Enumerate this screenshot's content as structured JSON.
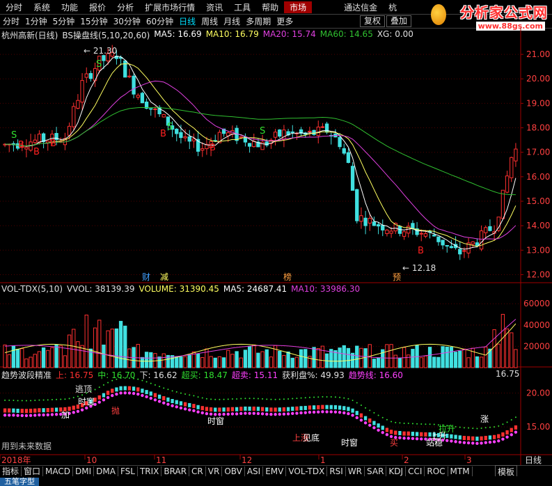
{
  "menubar": {
    "items": [
      "分时",
      "系统",
      "功能",
      "报价",
      "分析",
      "扩展市场行情",
      "资讯",
      "工具",
      "帮助",
      "市场",
      "通达信金",
      "杭"
    ],
    "selected": "市场"
  },
  "logo": {
    "name": "分析家公式网",
    "url": "www.88gs.com"
  },
  "periods": {
    "items": [
      "分时",
      "1分钟",
      "5分钟",
      "15分钟",
      "30分钟",
      "60分钟",
      "日线",
      "周线",
      "月线",
      "多周期",
      "更多"
    ],
    "selected": "日线",
    "right": [
      "复权",
      "叠加"
    ]
  },
  "main_legend": {
    "stock": "杭州高新(日线)",
    "indicator": "BS操盘线(5,10,20,60)",
    "ma5": "MA5: 16.69",
    "ma10": "MA10: 16.79",
    "ma20": "MA20: 15.74",
    "ma60": "MA60: 14.65",
    "xg": "XG: 0.00"
  },
  "vol_legend": {
    "name": "VOL-TDX(5,10)",
    "vvol": "VVOL: 38139.39",
    "volume": "VOLUME: 31390.45",
    "ma5": "MA5: 24687.41",
    "ma10": "MA10: 33986.30"
  },
  "trend_legend": {
    "name": "趋势波段精准",
    "up": "上: 16.75",
    "mid": "中: 16.70",
    "down": "下: 16.62",
    "overbuy": "超买: 18.47",
    "oversell": "超卖: 15.11",
    "profit": "获利盘%: 49.93",
    "trend": "趋势线: 16.60",
    "right": "16.75"
  },
  "main_axis": [
    "21.00",
    "20.00",
    "19.00",
    "18.00",
    "17.00",
    "16.00",
    "15.00",
    "14.00",
    "13.00",
    "12.00"
  ],
  "vol_axis": [
    "60000",
    "40000",
    "20000"
  ],
  "trend_axis": [
    "20.00",
    "15.00"
  ],
  "annotations": {
    "high": "21.30",
    "low": "12.18",
    "future": "用到未来数据",
    "cai": "财",
    "jian": "减",
    "bang": "榜",
    "yu": "预"
  },
  "signal_labels": {
    "b": "B",
    "s": "S",
    "top": "逃顶",
    "time": "时窗",
    "bottom": "见底",
    "add": "加",
    "sell": "抛",
    "up": "上涨",
    "buy": "买",
    "pull": "拉升",
    "rise": "上升",
    "stand": "站稳",
    "zhang": "涨"
  },
  "time_axis": [
    "2018年",
    "10",
    "11",
    "12",
    "1",
    "2",
    "3"
  ],
  "time_axis_right": "日线",
  "bottombar": {
    "items": [
      "指标",
      "窗口",
      "MACD",
      "DMI",
      "DMA",
      "FSL",
      "TRIX",
      "BRAR",
      "CR",
      "VR",
      "OBV",
      "ASI",
      "EMV",
      "VOL-TDX",
      "RSI",
      "WR",
      "SAR",
      "KDJ",
      "CCI",
      "ROC",
      "MTM"
    ],
    "right": "模板"
  },
  "status": {
    "label": "五笔字型"
  },
  "colors": {
    "up": "#ff3030",
    "down": "#40e0e0",
    "ma5": "#ffffff",
    "ma10": "#ffff60",
    "ma20": "#e040e0",
    "ma60": "#30c030",
    "axis": "#a00000"
  }
}
